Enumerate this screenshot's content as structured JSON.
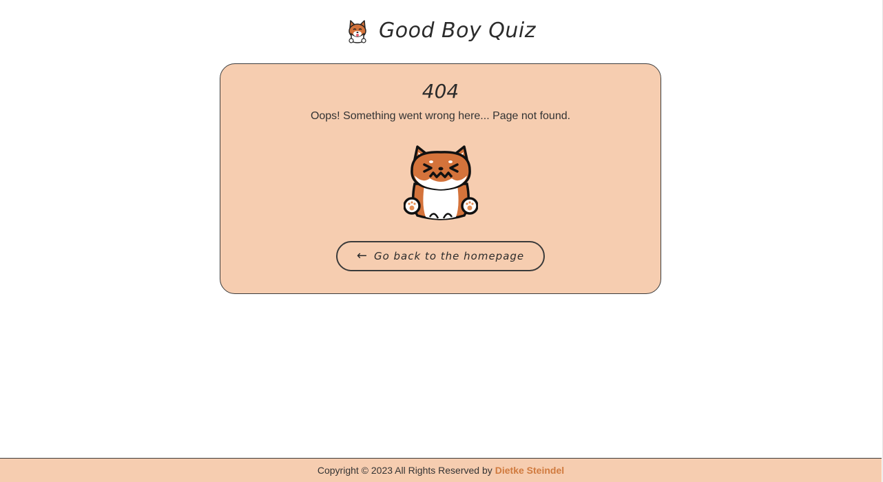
{
  "header": {
    "title": "Good Boy Quiz",
    "logo_icon": "shiba-dog-icon"
  },
  "error": {
    "code": "404",
    "message": "Oops! Something went wrong here... Page not found.",
    "mascot_icon": "sad-shiba-dog-icon"
  },
  "actions": {
    "back_icon": "arrow-left-icon",
    "back_label": "Go back to the homepage"
  },
  "footer": {
    "copyright": "Copyright © 2023 All Rights Reserved by",
    "author": "Dietke Steindel"
  },
  "colors": {
    "card_background": "#f6cdb0",
    "accent": "#d07a3e",
    "dog_orange": "#d4733b",
    "text": "#333333"
  }
}
